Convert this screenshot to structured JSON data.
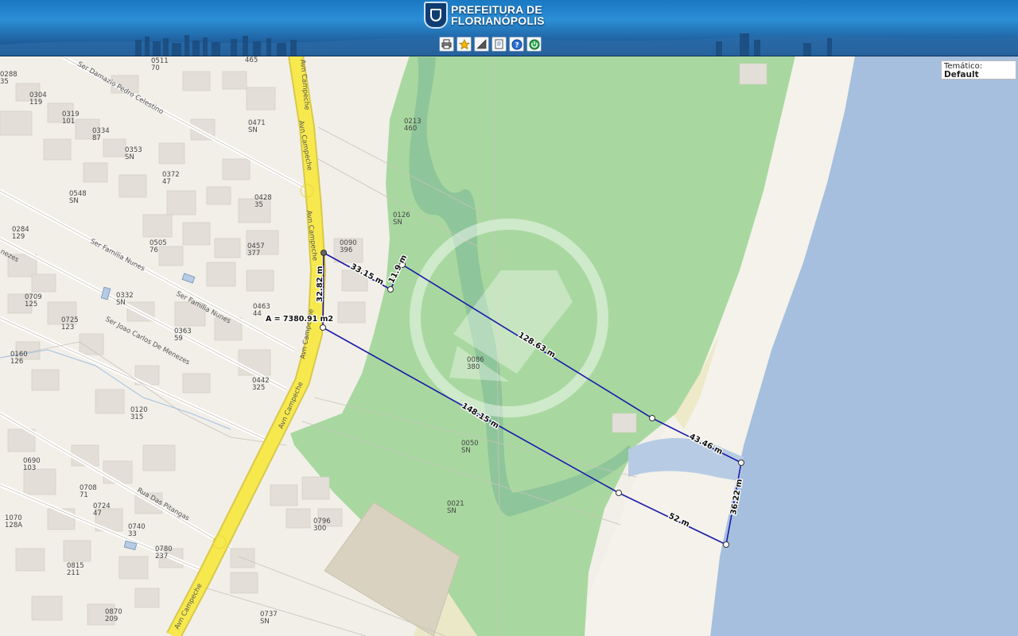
{
  "header": {
    "logo_line1": "PREFEITURA DE",
    "logo_line2": "FLORIANÓPOLIS",
    "toolbar": [
      {
        "name": "print-icon"
      },
      {
        "name": "star-icon"
      },
      {
        "name": "measure-icon"
      },
      {
        "name": "document-icon"
      },
      {
        "name": "help-icon"
      },
      {
        "name": "power-icon"
      }
    ]
  },
  "tematico": {
    "label": "Temático:",
    "value": "Default"
  },
  "measurement": {
    "area": "A = 7380.91 m2",
    "segments": [
      "33.15 m",
      "11.9 m",
      "128.63 m",
      "43.46 m",
      "36.22 m",
      "52 m",
      "148.15 m",
      "32.82 m"
    ]
  },
  "streets": [
    "Ser Damazio Pedro Celestino",
    "Avn Campeche",
    "Avn Campeche",
    "Avn Campeche",
    "Avn Campeche",
    "Ser Familia Nunes",
    "Ser Familia Nunes",
    "Ser Joao Carlos De Menezes",
    "Rua Das Pitangas",
    "Avn Campeche",
    "nezes"
  ],
  "parcels": [
    {
      "code": "0288",
      "num": "35"
    },
    {
      "code": "0511",
      "num": "70"
    },
    {
      "code": "465",
      "num": ""
    },
    {
      "code": "0304",
      "num": "119"
    },
    {
      "code": "0319",
      "num": "101"
    },
    {
      "code": "0334",
      "num": "87"
    },
    {
      "code": "0471",
      "num": "SN"
    },
    {
      "code": "0213",
      "num": "460"
    },
    {
      "code": "0353",
      "num": "SN"
    },
    {
      "code": "0372",
      "num": "47"
    },
    {
      "code": "0548",
      "num": "SN"
    },
    {
      "code": "0428",
      "num": "35"
    },
    {
      "code": "0126",
      "num": "SN"
    },
    {
      "code": "0284",
      "num": "129"
    },
    {
      "code": "0505",
      "num": "76"
    },
    {
      "code": "0457",
      "num": "377"
    },
    {
      "code": "0090",
      "num": "396"
    },
    {
      "code": "0709",
      "num": "125"
    },
    {
      "code": "0332",
      "num": "SN"
    },
    {
      "code": "0463",
      "num": "44"
    },
    {
      "code": "0725",
      "num": "123"
    },
    {
      "code": "0363",
      "num": "59"
    },
    {
      "code": "0160",
      "num": "126"
    },
    {
      "code": "0086",
      "num": "380"
    },
    {
      "code": "0442",
      "num": "325"
    },
    {
      "code": "0120",
      "num": "315"
    },
    {
      "code": "0690",
      "num": "103"
    },
    {
      "code": "0050",
      "num": "SN"
    },
    {
      "code": "0708",
      "num": "71"
    },
    {
      "code": "0724",
      "num": "47"
    },
    {
      "code": "0021",
      "num": "SN"
    },
    {
      "code": "1070",
      "num": "128A"
    },
    {
      "code": "0740",
      "num": "33"
    },
    {
      "code": "0796",
      "num": "300"
    },
    {
      "code": "0780",
      "num": "237"
    },
    {
      "code": "0815",
      "num": "211"
    },
    {
      "code": "0870",
      "num": "209"
    },
    {
      "code": "0737",
      "num": "SN"
    }
  ],
  "colors": {
    "land": "#f2efe9",
    "park": "#a8d8a0",
    "sea": "#a6bfde",
    "beach": "#f3f1ea",
    "road_major": "#f7e94d",
    "measure_line": "#1a1aa8"
  }
}
